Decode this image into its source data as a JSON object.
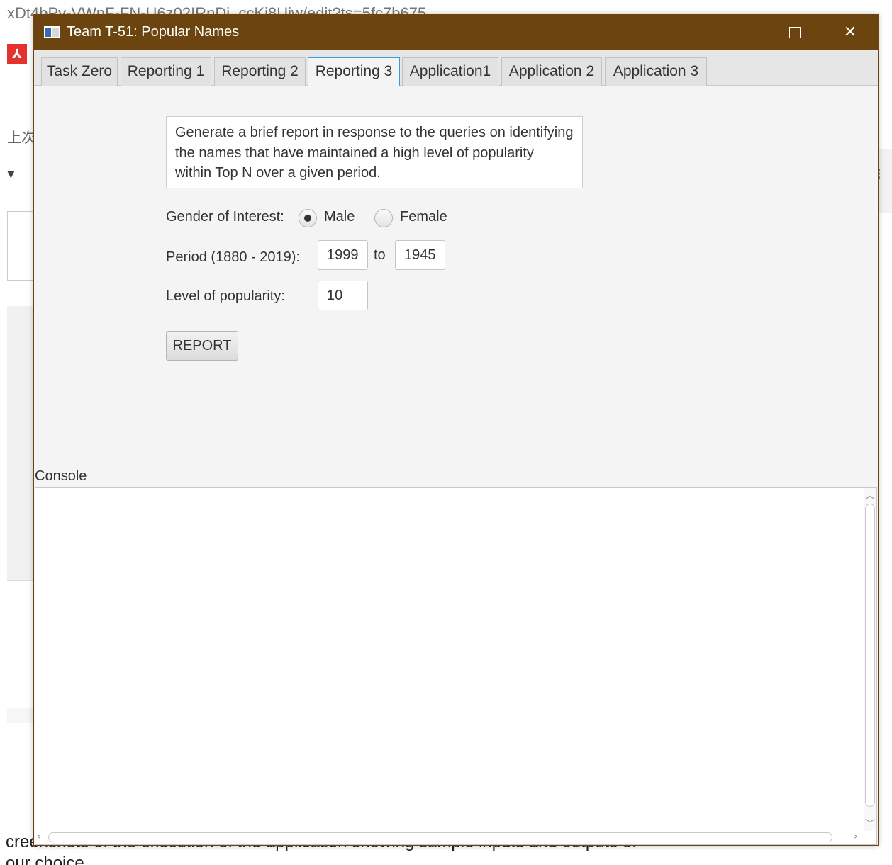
{
  "background": {
    "url_text": "xDt4bPv-VWnF-FN-U6z02IRnDi_ccKi8Uiw/edit?ts=5fc7b675",
    "cjk_text": "上次",
    "bottom_line1": "creenshots of the execution of the application showing sample inputs and outputs of",
    "bottom_line2": "our choice"
  },
  "window": {
    "title": "Team T-51:  Popular Names",
    "colors": {
      "titlebar": "#6b4410",
      "active_tab_border": "#3c9ad8"
    }
  },
  "tabs": [
    {
      "label": "Task Zero"
    },
    {
      "label": "Reporting 1"
    },
    {
      "label": "Reporting 2"
    },
    {
      "label": "Reporting 3",
      "active": true
    },
    {
      "label": "Application1"
    },
    {
      "label": "Application 2"
    },
    {
      "label": "Application 3"
    }
  ],
  "form": {
    "description": "Generate a brief report in response to the queries on identifying the names that have maintained a high level of popularity within Top N over a given period.",
    "gender_label": "Gender of Interest:",
    "gender_options": [
      {
        "label": "Male",
        "selected": true
      },
      {
        "label": "Female",
        "selected": false
      }
    ],
    "period_label": "Period (1880 - 2019):",
    "period_start": "1999",
    "period_to": "to",
    "period_end": "1945",
    "popularity_label": "Level of popularity:",
    "popularity_value": "10",
    "report_button": "REPORT"
  },
  "console": {
    "label": "Console",
    "content": ""
  }
}
